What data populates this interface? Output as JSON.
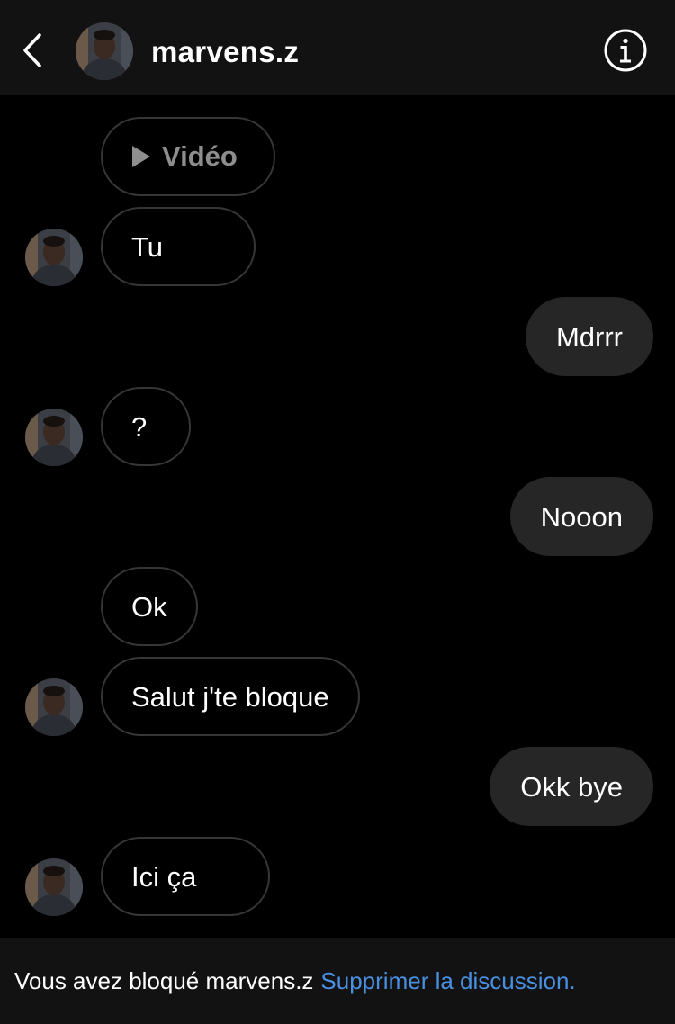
{
  "header": {
    "username": "marvens.z",
    "back_icon": "chevron-left-icon",
    "info_icon": "info-circle-icon"
  },
  "messages": [
    {
      "direction": "incoming",
      "type": "video",
      "label": "Vidéo",
      "icon": "play-icon"
    },
    {
      "direction": "incoming",
      "type": "text",
      "text": "Tu"
    },
    {
      "direction": "outgoing",
      "type": "text",
      "text": "Mdrrr"
    },
    {
      "direction": "incoming",
      "type": "text",
      "text": "?"
    },
    {
      "direction": "outgoing",
      "type": "text",
      "text": "Nooon"
    },
    {
      "direction": "incoming",
      "type": "text",
      "text": "Ok"
    },
    {
      "direction": "incoming",
      "type": "text",
      "text": "Salut j't​e bloque"
    },
    {
      "direction": "outgoing",
      "type": "text",
      "text": "Okk bye"
    },
    {
      "direction": "incoming",
      "type": "text",
      "text": "Ici ça"
    }
  ],
  "footer": {
    "blocked_text": "Vous avez bloqué marvens.z",
    "delete_link": "Supprimer la discussion."
  },
  "colors": {
    "background": "#000000",
    "header_bg": "#121212",
    "outgoing_bubble": "#262626",
    "incoming_border": "#363636",
    "link": "#4a90e2",
    "muted_text": "#8e8e8e"
  }
}
